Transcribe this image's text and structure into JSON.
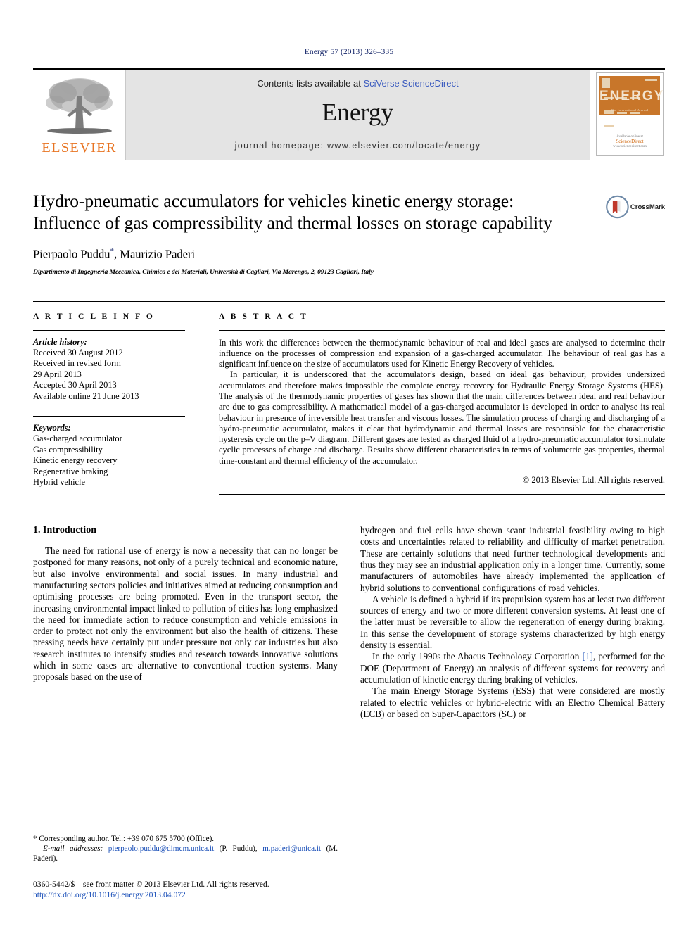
{
  "running_head": "Energy 57 (2013) 326–335",
  "masthead": {
    "publisher_name": "ELSEVIER",
    "contents_prefix": "Contents lists available at ",
    "contents_link": "SciVerse ScienceDirect",
    "journal_name": "Energy",
    "homepage": "journal homepage: www.elsevier.com/locate/energy",
    "cover": {
      "title": "ENERGY",
      "subtitle": "The International Journal",
      "footer_brand": "ScienceDirect",
      "footer_prefix": "Available online at",
      "footer_url": "www.sciencedirect.com"
    }
  },
  "article": {
    "title": "Hydro-pneumatic accumulators for vehicles kinetic energy storage: Influence of gas compressibility and thermal losses on storage capability",
    "authors": "Pierpaolo Puddu",
    "author_marker": "*",
    "authors_rest": ", Maurizio Paderi",
    "affiliation": "Dipartimento di Ingegneria Meccanica, Chimica e dei Materiali, Università di Cagliari, Via Marengo, 2, 09123 Cagliari, Italy",
    "crossmark_label": "CrossMark"
  },
  "article_info": {
    "heading": "A R T I C L E  I N F O",
    "history_label": "Article history:",
    "history": [
      "Received 30 August 2012",
      "Received in revised form",
      "29 April 2013",
      "Accepted 30 April 2013",
      "Available online 21 June 2013"
    ],
    "keywords_label": "Keywords:",
    "keywords": [
      "Gas-charged accumulator",
      "Gas compressibility",
      "Kinetic energy recovery",
      "Regenerative braking",
      "Hybrid vehicle"
    ]
  },
  "abstract": {
    "heading": "A B S T R A C T",
    "paragraphs": [
      "In this work the differences between the thermodynamic behaviour of real and ideal gases are analysed to determine their influence on the processes of compression and expansion of a gas-charged accumulator. The behaviour of real gas has a significant influence on the size of accumulators used for Kinetic Energy Recovery of vehicles.",
      "In particular, it is underscored that the accumulator's design, based on ideal gas behaviour, provides undersized accumulators and therefore makes impossible the complete energy recovery for Hydraulic Energy Storage Systems (HES). The analysis of the thermodynamic properties of gases has shown that the main differences between ideal and real behaviour are due to gas compressibility. A mathematical model of a gas-charged accumulator is developed in order to analyse its real behaviour in presence of irreversible heat transfer and viscous losses. The simulation process of charging and discharging of a hydro-pneumatic accumulator, makes it clear that hydrodynamic and thermal losses are responsible for the characteristic hysteresis cycle on the p–V diagram. Different gases are tested as charged fluid of a hydro-pneumatic accumulator to simulate cyclic processes of charge and discharge. Results show different characteristics in terms of volumetric gas properties, thermal time-constant and thermal efficiency of the accumulator."
    ],
    "copyright": "© 2013 Elsevier Ltd. All rights reserved."
  },
  "body": {
    "section_number_title": "1. Introduction",
    "left_paragraphs": [
      "The need for rational use of energy is now a necessity that can no longer be postponed for many reasons, not only of a purely technical and economic nature, but also involve environmental and social issues. In many industrial and manufacturing sectors policies and initiatives aimed at reducing consumption and optimising processes are being promoted. Even in the transport sector, the increasing environmental impact linked to pollution of cities has long emphasized the need for immediate action to reduce consumption and vehicle emissions in order to protect not only the environment but also the health of citizens. These pressing needs have certainly put under pressure not only car industries but also research institutes to intensify studies and research towards innovative solutions which in some cases are alternative to conventional traction systems. Many proposals based on the use of"
    ],
    "right_paragraphs": [
      "hydrogen and fuel cells have shown scant industrial feasibility owing to high costs and uncertainties related to reliability and difficulty of market penetration. These are certainly solutions that need further technological developments and thus they may see an industrial application only in a longer time. Currently, some manufacturers of automobiles have already implemented the application of hybrid solutions to conventional configurations of road vehicles.",
      "A vehicle is defined a hybrid if its propulsion system has at least two different sources of energy and two or more different conversion systems. At least one of the latter must be reversible to allow the regeneration of energy during braking. In this sense the development of storage systems characterized by high energy density is essential.",
      "The main Energy Storage Systems (ESS) that were considered are mostly related to electric vehicles or hybrid-electric with an Electro Chemical Battery (ECB) or based on Super-Capacitors (SC) or"
    ],
    "citation_paragraph_prefix": "In the early 1990s the Abacus Technology Corporation ",
    "citation_label": "[1]",
    "citation_paragraph_suffix": ", performed for the DOE (Department of Energy) an analysis of different systems for recovery and accumulation of kinetic energy during braking of vehicles."
  },
  "footnotes": {
    "corresponding": "* Corresponding author. Tel.: +39 070 675 5700 (Office).",
    "email_label": "E-mail addresses:",
    "email_1": "pierpaolo.puddu@dimcm.unica.it",
    "email_1_owner": " (P. Puddu), ",
    "email_2": "m.paderi@unica.it",
    "email_2_owner": " (M. Paderi).",
    "imprint": "0360-5442/$ – see front matter © 2013 Elsevier Ltd. All rights reserved.",
    "doi": "http://dx.doi.org/10.1016/j.energy.2013.04.072"
  },
  "colors": {
    "elsevier_orange": "#E87422",
    "link_blue": "#1a4fb8",
    "running_head_blue": "#1a2a6c",
    "cover_band": "#C8762A",
    "masthead_grey": "#e4e4e4"
  }
}
